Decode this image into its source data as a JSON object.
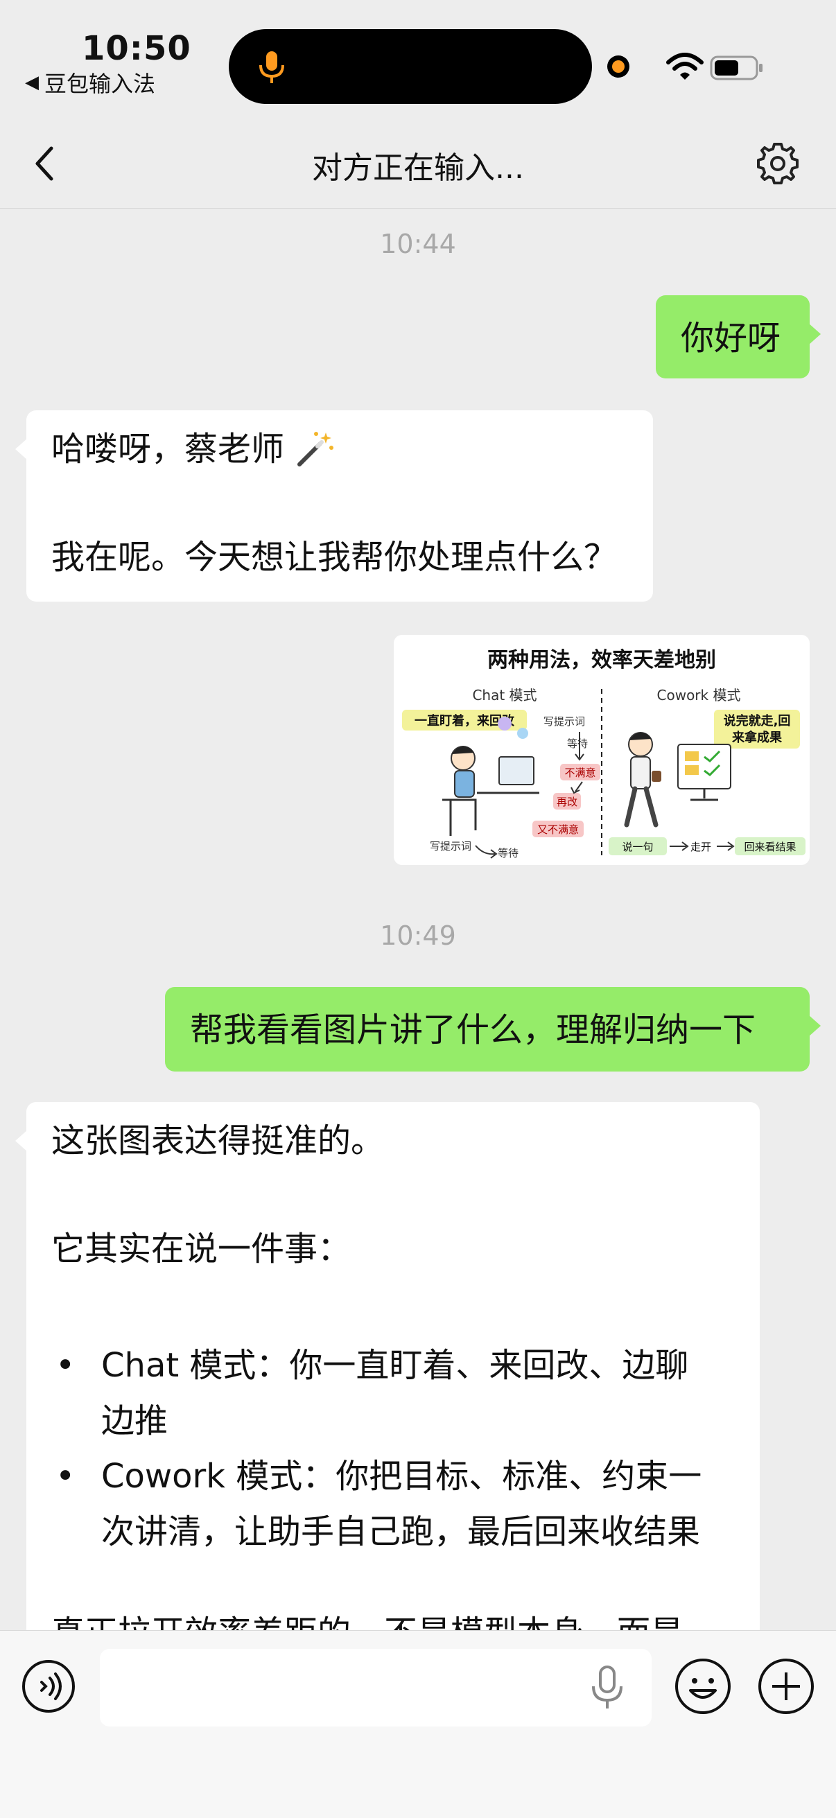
{
  "status_bar": {
    "time": "10:50",
    "back_app": "豆包输入法"
  },
  "nav": {
    "title": "对方正在输入..."
  },
  "messages": {
    "ts1": "10:44",
    "m1": "你好呀",
    "m2_line1": "哈喽呀，蔡老师",
    "m2_line2": "我在呢。今天想让我帮你处理点什么？",
    "ts2": "10:49",
    "m3": "帮我看看图片讲了什么，理解归纳一下",
    "m4_intro": "这张图表达得挺准的。",
    "m4_lead": "它其实在说一件事：",
    "m4_items": [
      "Chat 模式：你一直盯着、来回改、边聊边推",
      "Cowork 模式：你把目标、标准、约束一次讲清，让助手自己跑，最后回来收结果"
    ],
    "m4_cut": "真正拉开效率差距的，不是模型本身，而是"
  },
  "image": {
    "title": "两种用法，效率天差地别",
    "left_label": "Chat 模式",
    "right_label": "Cowork 模式",
    "tag_left": "一直盯着，来回改",
    "tag_right_1": "说完就走,回",
    "tag_right_2": "来拿成果",
    "loop_1": "写提示词",
    "loop_2": "等待",
    "loop_3": "不满意",
    "loop_4": "再改",
    "loop_5": "又不满意",
    "bottom_left_1": "写提示词",
    "bottom_left_2": "等待",
    "bottom_right_1": "说一句",
    "bottom_right_2": "走开",
    "bottom_right_3": "回来看结果"
  },
  "colors": {
    "my_bubble": "#95ec69",
    "other_bubble": "#ffffff",
    "background": "#ededed",
    "recording_dot": "#ff9a1f"
  }
}
